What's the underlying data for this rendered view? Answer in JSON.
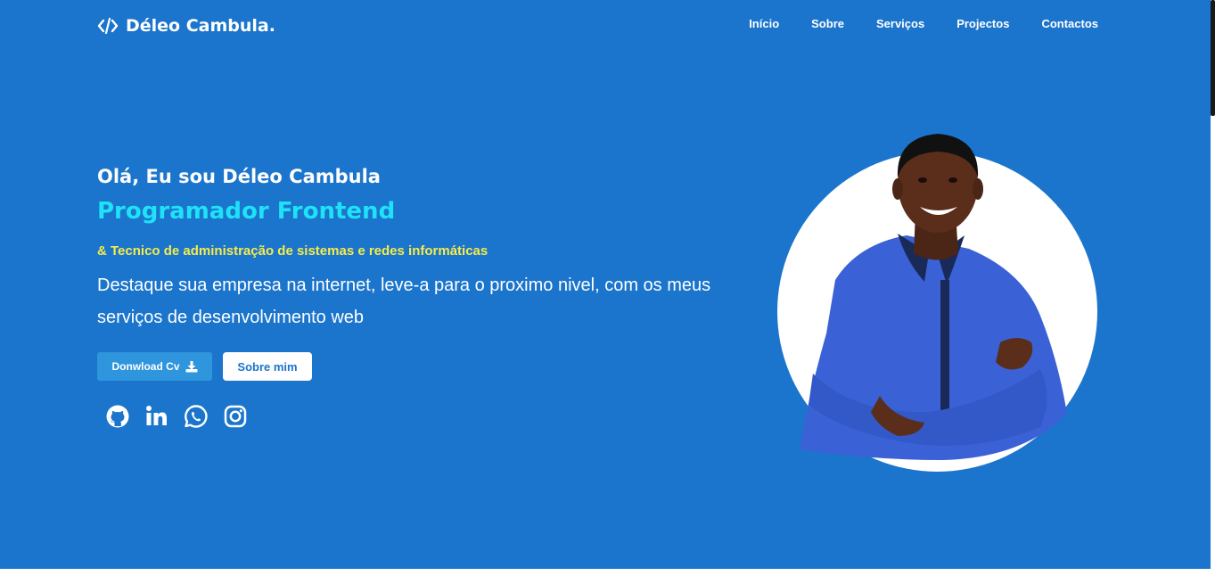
{
  "header": {
    "brand_icon": "code-icon",
    "brand_name": "Déleo Cambula.",
    "nav": [
      {
        "label": "Início"
      },
      {
        "label": "Sobre"
      },
      {
        "label": "Serviços"
      },
      {
        "label": "Projectos"
      },
      {
        "label": "Contactos"
      }
    ]
  },
  "hero": {
    "greeting": "Olá, Eu sou Déleo Cambula",
    "role": "Programador Frontend",
    "subrole": "& Tecnico de administração de sistemas e redes informáticas",
    "tagline": "Destaque sua empresa na internet, leve-a para o proximo nivel, com os meus serviços de desenvolvimento web",
    "download_cv_label": "Donwload Cv",
    "download_icon": "download-icon",
    "about_label": "Sobre mim",
    "socials": [
      "github-icon",
      "linkedin-icon",
      "whatsapp-icon",
      "instagram-icon"
    ],
    "portrait": "profile-photo"
  },
  "colors": {
    "hero_bg": "#1b75cc",
    "role": "#1fe1f7",
    "subrole": "#f6ec4a",
    "cv_button": "#2f95dc"
  }
}
